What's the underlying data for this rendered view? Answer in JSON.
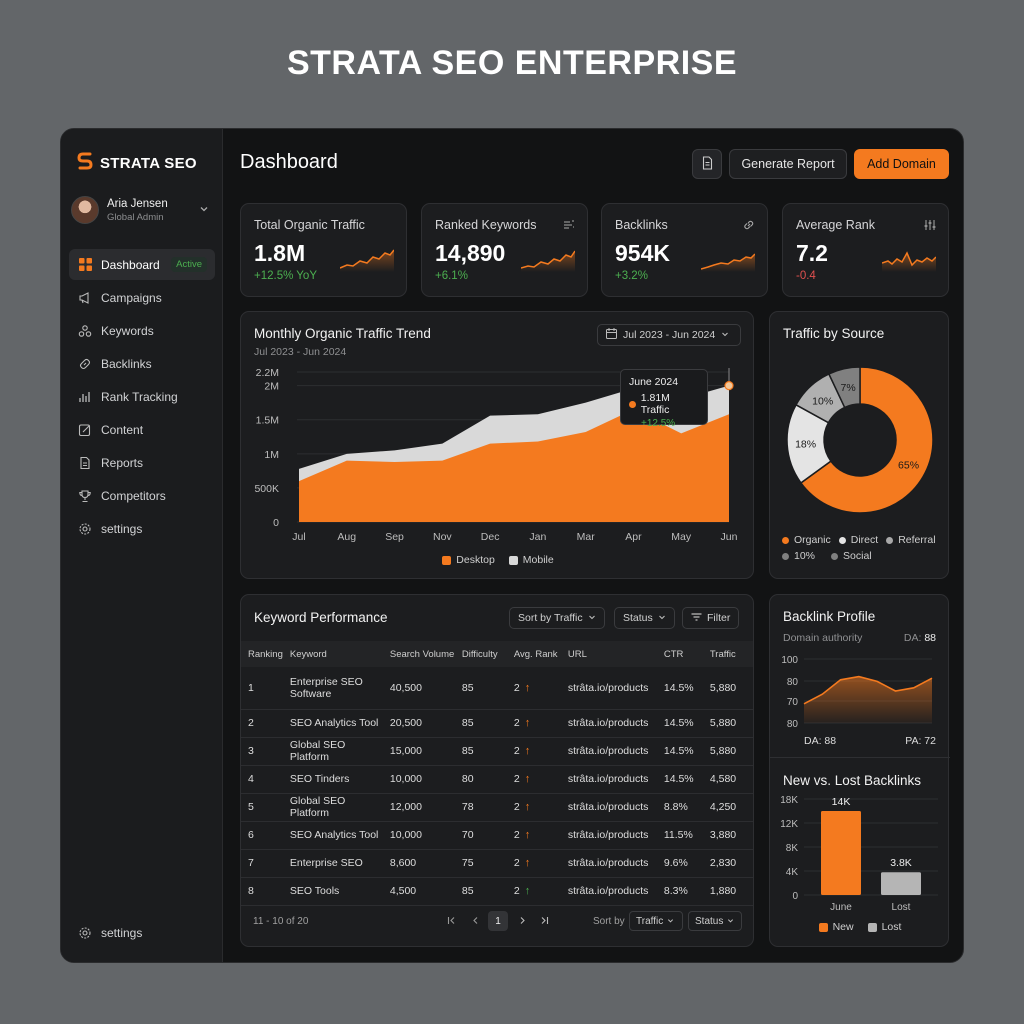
{
  "page_title": "STRATA SEO ENTERPRISE",
  "colors": {
    "accent": "#f47a1f",
    "positive": "#4caf50",
    "negative": "#e0504f",
    "mobile": "#d8d8d8"
  },
  "sidebar": {
    "brand": "STRATA SEO",
    "user": {
      "name": "Aria Jensen",
      "role": "Global Admin"
    },
    "items": [
      {
        "label": "Dashboard",
        "icon": "grid-icon",
        "badge": "Active"
      },
      {
        "label": "Campaigns",
        "icon": "megaphone-icon"
      },
      {
        "label": "Keywords",
        "icon": "keywords-icon"
      },
      {
        "label": "Backlinks",
        "icon": "link-icon"
      },
      {
        "label": "Rank Tracking",
        "icon": "bars-icon"
      },
      {
        "label": "Content",
        "icon": "edit-icon"
      },
      {
        "label": "Reports",
        "icon": "document-icon"
      },
      {
        "label": "Competitors",
        "icon": "trophy-icon"
      },
      {
        "label": "settings",
        "icon": "gear-icon"
      }
    ],
    "bottom": {
      "label": "settings",
      "icon": "gear-icon"
    }
  },
  "header": {
    "title": "Dashboard",
    "generate_label": "Generate Report",
    "add_label": "Add Domain"
  },
  "stats": [
    {
      "label": "Total Organic Traffic",
      "value": "1.8M",
      "delta": "+12.5% YoY",
      "trend": "up"
    },
    {
      "label": "Ranked Keywords",
      "value": "14,890",
      "delta": "+6.1%",
      "trend": "up",
      "icon": "filter-list-icon"
    },
    {
      "label": "Backlinks",
      "value": "954K",
      "delta": "+3.2%",
      "trend": "up",
      "icon": "link-icon"
    },
    {
      "label": "Average Rank",
      "value": "7.2",
      "delta": "-0.4",
      "trend": "down",
      "icon": "sliders-icon"
    }
  ],
  "trend_card": {
    "title": "Monthly Organic Traffic Trend",
    "subtitle": "Jul 2023 - Jun 2024",
    "date_range": "Jul 2023 - Jun 2024",
    "tooltip": {
      "title": "June 2024",
      "value": "1.81M Traffic",
      "delta": "+12.5%"
    },
    "legend": [
      "Desktop",
      "Mobile"
    ]
  },
  "source_card": {
    "title": "Traffic by Source"
  },
  "keyword_card": {
    "title": "Keyword Performance",
    "sort_label": "Sort by Traffic",
    "status_label": "Status",
    "filter_label": "Filter",
    "columns": [
      "Ranking",
      "Keyword",
      "Search Volume",
      "Difficulty",
      "Avg. Rank",
      "URL",
      "CTR",
      "Traffic"
    ],
    "rows": [
      [
        "1",
        "Enterprise SEO Software",
        "40,500",
        "85",
        "2",
        "strâta.io/products",
        "14.5%",
        "5,880"
      ],
      [
        "2",
        "SEO Analytics Tool",
        "20,500",
        "85",
        "2",
        "strâta.io/products",
        "14.5%",
        "5,880"
      ],
      [
        "3",
        "Global SEO Platform",
        "15,000",
        "85",
        "2",
        "strâta.io/products",
        "14.5%",
        "5,880"
      ],
      [
        "4",
        "SEO Tinders",
        "10,000",
        "80",
        "2",
        "strâta.io/products",
        "14.5%",
        "4,580"
      ],
      [
        "5",
        "Global SEO Platform",
        "12,000",
        "78",
        "2",
        "strâta.io/products",
        "8.8%",
        "4,250"
      ],
      [
        "6",
        "SEO Analytics Tool",
        "10,000",
        "70",
        "2",
        "strâta.io/products",
        "11.5%",
        "3,880"
      ],
      [
        "7",
        "Enterprise SEO",
        "8,600",
        "75",
        "2",
        "strâta.io/products",
        "9.6%",
        "2,830"
      ],
      [
        "8",
        "SEO Tools",
        "4,500",
        "85",
        "2",
        "strâta.io/products",
        "8.3%",
        "1,880"
      ]
    ],
    "rank_arrows": [
      "up",
      "up",
      "up",
      "up",
      "up",
      "up",
      "up",
      "up-green"
    ],
    "pagination": {
      "range": "11 - 10 of 20",
      "page": "1",
      "sort_by": "Sort by",
      "sort_value": "Traffic",
      "status": "Status"
    }
  },
  "backlink_card": {
    "title": "Backlink Profile",
    "subtitle": "Domain authority",
    "da_label": "DA:",
    "da_value": "88",
    "da_bottom": "DA: 88",
    "pa_bottom": "PA: 72"
  },
  "newlost_card": {
    "title": "New vs. Lost Backlinks"
  },
  "chart_data": [
    {
      "type": "area",
      "title": "Monthly Organic Traffic Trend",
      "categories": [
        "Jul",
        "Aug",
        "Sep",
        "Nov",
        "Dec",
        "Jan",
        "Mar",
        "Apr",
        "May",
        "Jun"
      ],
      "ytick_labels": [
        "0",
        "500K",
        "1M",
        "1.5M",
        "2M",
        "2.2M"
      ],
      "ytick_values": [
        0,
        500000,
        1000000,
        1500000,
        2000000,
        2200000
      ],
      "ylim": [
        0,
        2200000
      ],
      "series": [
        {
          "name": "Desktop",
          "values": [
            600000,
            900000,
            880000,
            900000,
            1150000,
            1180000,
            1320000,
            1650000,
            1300000,
            1580000
          ]
        },
        {
          "name": "Mobile",
          "values": [
            780000,
            1000000,
            1050000,
            1150000,
            1560000,
            1580000,
            1750000,
            1960000,
            1800000,
            2000000
          ]
        }
      ],
      "legend": "bottom",
      "grid": true
    },
    {
      "type": "pie",
      "title": "Traffic by Source",
      "labels": [
        "Organic",
        "Direct",
        "Referral",
        "Social"
      ],
      "values": [
        65,
        18,
        10,
        7
      ],
      "slice_labels": [
        "65%",
        "18%",
        "10%",
        "7%"
      ],
      "legend_items": [
        "Organic",
        "Direct",
        "Referral",
        "10%",
        "Social"
      ],
      "colors": [
        "#f47a1f",
        "#e4e4e4",
        "#b0b0b0",
        "#808080"
      ],
      "legend": "bottom"
    },
    {
      "type": "area",
      "title": "Backlink Profile",
      "ytick_labels": [
        "100",
        "80",
        "70",
        "80"
      ],
      "ylim": [
        60,
        100
      ],
      "values": [
        72,
        78,
        87,
        89,
        86,
        80,
        82,
        88
      ],
      "grid": true
    },
    {
      "type": "bar",
      "title": "New vs. Lost Backlinks",
      "categories": [
        "June",
        "Lost"
      ],
      "series": [
        {
          "name": "New",
          "values": [
            14000
          ]
        },
        {
          "name": "Lost",
          "values": [
            3800
          ]
        }
      ],
      "data_labels": [
        "14K",
        "3.8K"
      ],
      "ytick_labels": [
        "0",
        "4K",
        "8K",
        "12K",
        "18K"
      ],
      "ytick_values": [
        0,
        4000,
        8000,
        12000,
        16000
      ],
      "ylim": [
        0,
        16000
      ],
      "legend": "bottom",
      "grid": true
    }
  ]
}
